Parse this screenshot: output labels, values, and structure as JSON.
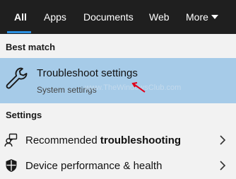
{
  "tabs": [
    {
      "label": "All",
      "active": true
    },
    {
      "label": "Apps",
      "active": false
    },
    {
      "label": "Documents",
      "active": false
    },
    {
      "label": "Web",
      "active": false
    },
    {
      "label": "More",
      "active": false
    }
  ],
  "colors": {
    "tab_bar": "#1f1f1f",
    "active_underline": "#2a8fe0",
    "panel": "#f2f2f2",
    "selected_row": "#a6cbe8",
    "annotation_arrow": "#e0001a"
  },
  "best_match": {
    "section_label": "Best match",
    "title": "Troubleshoot settings",
    "subtitle": "System settings",
    "icon": "wrench-icon",
    "watermark": "www.TheWindowsClub.com"
  },
  "settings": {
    "section_label": "Settings",
    "items": [
      {
        "label_prefix": "Recommended ",
        "label_bold": "troubleshooting",
        "icon": "person-chat-icon"
      },
      {
        "label": "Device performance & health",
        "icon": "shield-icon"
      }
    ]
  }
}
